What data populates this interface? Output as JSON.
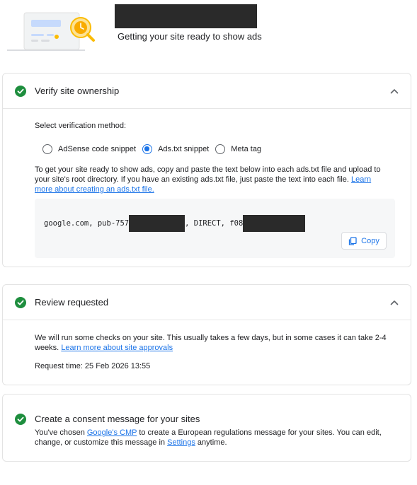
{
  "header": {
    "subtitle": "Getting your site ready to show ads"
  },
  "verify": {
    "title": "Verify site ownership",
    "select_label": "Select verification method:",
    "methods": [
      "AdSense code snippet",
      "Ads.txt snippet",
      "Meta tag"
    ],
    "selected_method": "Ads.txt snippet",
    "instructions": "To get your site ready to show ads, copy and paste the text below into each ads.txt file and upload to your site's root directory. If you have an existing ads.txt file, just paste the text into each file.",
    "learn_more": "Learn more about creating an ads.txt file.",
    "code_part1": "google.com, pub-757",
    "code_part2": ", DIRECT, f08",
    "copy_label": "Copy"
  },
  "review": {
    "title": "Review requested",
    "text": "We will run some checks on your site. This usually takes a few days, but in some cases it can take 2-4 weeks.",
    "learn_more": "Learn more about site approvals",
    "request_time": "Request time: 25 Feb 2026 13:55"
  },
  "consent": {
    "title": "Create a consent message for your sites",
    "text_before": "You've chosen",
    "cmp_link": "Google's CMP",
    "text_middle": "to create a European regulations message for your sites. You can edit, change, or customize this message in",
    "settings_link": "Settings",
    "text_after": "anytime."
  },
  "colors": {
    "success": "#1e8e3e",
    "accent": "#1a73e8"
  }
}
